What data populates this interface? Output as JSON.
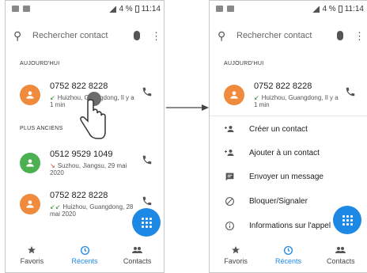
{
  "status": {
    "battery": "4 %",
    "time": "11:14"
  },
  "search": {
    "placeholder": "Rechercher contact"
  },
  "left": {
    "section_today": "AUJOURD'HUI",
    "section_older": "PLUS ANCIENS",
    "calls": [
      {
        "number": "0752 822 8228",
        "detail": "Huizhou, Guangdong, Il y a 1 min",
        "avatar_color": "#f08a3c",
        "direction": "incoming"
      },
      {
        "number": "0512 9529 1049",
        "detail": "Suzhou, Jiangsu, 29 mai 2020",
        "avatar_color": "#4caf50",
        "direction": "missed"
      },
      {
        "number": "0752 822 8228",
        "detail": "Huizhou, Guangdong, 28 mai 2020",
        "avatar_color": "#f08a3c",
        "direction": "incoming-double"
      }
    ]
  },
  "right": {
    "section_today": "AUJOURD'HUI",
    "call": {
      "number": "0752 822 8228",
      "detail": "Huizhou, Guangdong, Il y a 1 min",
      "avatar_color": "#f08a3c"
    },
    "menu": [
      {
        "label": "Créer un contact",
        "icon": "add-person-icon"
      },
      {
        "label": "Ajouter à un contact",
        "icon": "add-person-icon"
      },
      {
        "label": "Envoyer un message",
        "icon": "message-icon"
      },
      {
        "label": "Bloquer/Signaler",
        "icon": "block-icon"
      },
      {
        "label": "Informations sur l'appel",
        "icon": "info-icon"
      }
    ]
  },
  "tabs": [
    {
      "label": "Favoris",
      "icon": "star-icon",
      "active": false
    },
    {
      "label": "Récents",
      "icon": "clock-icon",
      "active": true
    },
    {
      "label": "Contacts",
      "icon": "people-icon",
      "active": false
    }
  ],
  "colors": {
    "accent": "#1e88e5",
    "orange": "#f08a3c",
    "green": "#4caf50"
  }
}
